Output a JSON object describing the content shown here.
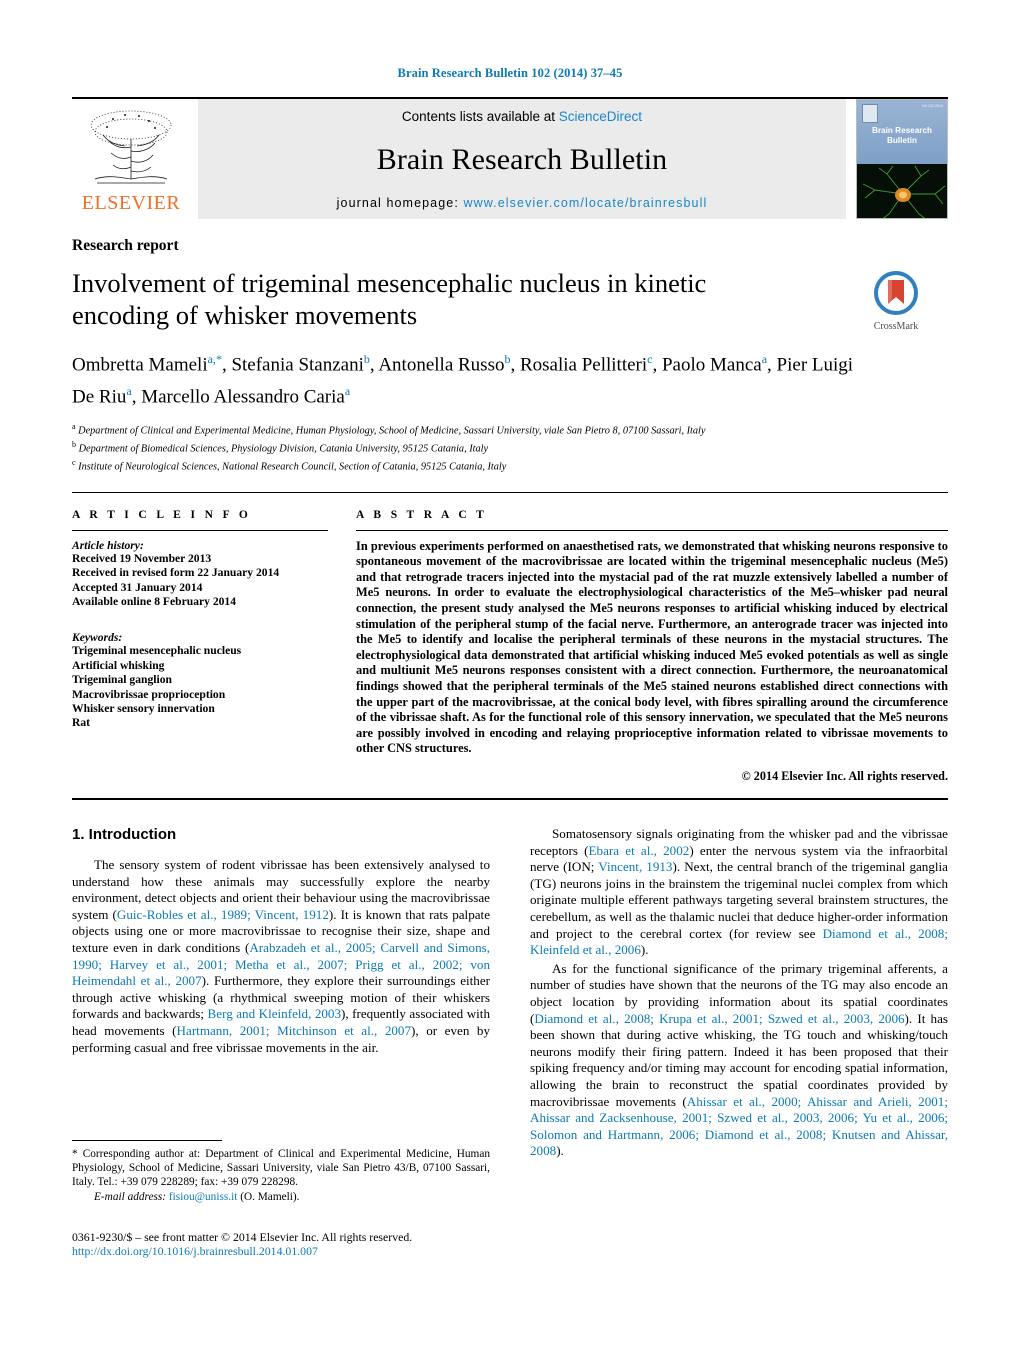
{
  "running_head": "Brain Research Bulletin 102 (2014) 37–45",
  "masthead": {
    "publisher_logo_name": "elsevier-tree-logo",
    "publisher_wordmark": "ELSEVIER",
    "contents_prefix": "Contents lists available at",
    "contents_link": "ScienceDirect",
    "journal_title": "Brain Research Bulletin",
    "homepage_label": "journal homepage:",
    "homepage_url": "www.elsevier.com/locate/brainresbull",
    "cover": {
      "journal_name_line1": "Brain Research",
      "journal_name_line2": "Bulletin",
      "issue_note": "Vol 102  2014"
    }
  },
  "article": {
    "type": "Research report",
    "title": "Involvement of trigeminal mesencephalic nucleus in kinetic encoding of whisker movements",
    "crossmark_label": "CrossMark",
    "authors_html": "Ombretta Mameli<sup>a,</sup><sup>*</sup>, Stefania Stanzani<sup>b</sup>, Antonella Russo<sup>b</sup>, Rosalia Pellitteri<sup>c</sup>, Paolo Manca<sup>a</sup>, Pier Luigi De Riu<sup>a</sup>, Marcello Alessandro Caria<sup>a</sup>",
    "affiliations": [
      {
        "marker": "a",
        "text": "Department of Clinical and Experimental Medicine, Human Physiology, School of Medicine, Sassari University, viale San Pietro 8, 07100 Sassari, Italy"
      },
      {
        "marker": "b",
        "text": "Department of Biomedical Sciences, Physiology Division, Catania University, 95125 Catania, Italy"
      },
      {
        "marker": "c",
        "text": "Institute of Neurological Sciences, National Research Council, Section of Catania, 95125 Catania, Italy"
      }
    ]
  },
  "article_info": {
    "heading": "A R T I C L E   I N F O",
    "history_label": "Article history:",
    "history": [
      "Received 19 November 2013",
      "Received in revised form 22 January 2014",
      "Accepted 31 January 2014",
      "Available online 8 February 2014"
    ],
    "keywords_label": "Keywords:",
    "keywords": [
      "Trigeminal mesencephalic nucleus",
      "Artificial whisking",
      "Trigeminal ganglion",
      "Macrovibrissae proprioception",
      "Whisker sensory innervation",
      "Rat"
    ]
  },
  "abstract": {
    "heading": "A B S T R A C T",
    "text": "In previous experiments performed on anaesthetised rats, we demonstrated that whisking neurons responsive to spontaneous movement of the macrovibrissae are located within the trigeminal mesencephalic nucleus (Me5) and that retrograde tracers injected into the mystacial pad of the rat muzzle extensively labelled a number of Me5 neurons. In order to evaluate the electrophysiological characteristics of the Me5–whisker pad neural connection, the present study analysed the Me5 neurons responses to artificial whisking induced by electrical stimulation of the peripheral stump of the facial nerve. Furthermore, an anterograde tracer was injected into the Me5 to identify and localise the peripheral terminals of these neurons in the mystacial structures. The electrophysiological data demonstrated that artificial whisking induced Me5 evoked potentials as well as single and multiunit Me5 neurons responses consistent with a direct connection. Furthermore, the neuroanatomical findings showed that the peripheral terminals of the Me5 stained neurons established direct connections with the upper part of the macrovibrissae, at the conical body level, with fibres spiralling around the circumference of the vibrissae shaft. As for the functional role of this sensory innervation, we speculated that the Me5 neurons are possibly involved in encoding and relaying proprioceptive information related to vibrissae movements to other CNS structures.",
    "copyright": "© 2014 Elsevier Inc. All rights reserved."
  },
  "body": {
    "section_number_title": "1.  Introduction",
    "left_paragraphs_html": [
      "The sensory system of rodent vibrissae has been extensively analysed to understand how these animals may successfully explore the nearby environment, detect objects and orient their behaviour using the macrovibrissae system (<span class=\"cite\">Guic-Robles et al., 1989; Vincent, 1912</span>). It is known that rats palpate objects using one or more macrovibrissae to recognise their size, shape and texture even in dark conditions (<span class=\"cite\">Arabzadeh et al., 2005; Carvell and Simons, 1990; Harvey et al., 2001; Metha et al., 2007; Prigg et al., 2002; von Heimendahl et al., 2007</span>). Furthermore, they explore their surroundings either through active whisking (a rhythmical sweeping motion of their whiskers forwards and backwards; <span class=\"cite\">Berg and Kleinfeld, 2003</span>), frequently associated with head movements (<span class=\"cite\">Hartmann, 2001; Mitchinson et al., 2007</span>), or even by performing casual and free vibrissae movements in the air."
    ],
    "right_paragraphs_html": [
      "Somatosensory signals originating from the whisker pad and the vibrissae receptors (<span class=\"cite\">Ebara et al., 2002</span>) enter the nervous system via the infraorbital nerve (ION; <span class=\"cite\">Vincent, 1913</span>). Next, the central branch of the trigeminal ganglia (TG) neurons joins in the brainstem the trigeminal nuclei complex from which originate multiple efferent pathways targeting several brainstem structures, the cerebellum, as well as the thalamic nuclei that deduce higher-order information and project to the cerebral cortex (for review see <span class=\"cite\">Diamond et al., 2008; Kleinfeld et al., 2006</span>).",
      "As for the functional significance of the primary trigeminal afferents, a number of studies have shown that the neurons of the TG may also encode an object location by providing information about its spatial coordinates (<span class=\"cite\">Diamond et al., 2008; Krupa et al., 2001; Szwed et al., 2003, 2006</span>). It has been shown that during active whisking, the TG touch and whisking/touch neurons modify their firing pattern. Indeed it has been proposed that their spiking frequency and/or timing may account for encoding spatial information, allowing the brain to reconstruct the spatial coordinates provided by macrovibrissae movements (<span class=\"cite\">Ahissar et al., 2000; Ahissar and Arieli, 2001; Ahissar and Zacksenhouse, 2001; Szwed et al., 2003, 2006; Yu et al., 2006; Solomon and Hartmann, 2006; Diamond et al., 2008; Knutsen and Ahissar, 2008</span>)."
    ]
  },
  "footnote": {
    "corresponding_html": "* Corresponding author at: Department of Clinical and Experimental Medicine, Human Physiology, School of Medicine, Sassari University, viale San Pietro 43/B, 07100 Sassari, Italy. Tel.: +39 079 228289; fax: +39 079 228298.",
    "email_label": "E-mail address:",
    "email": "fisiou@uniss.it",
    "email_owner": "(O. Mameli)."
  },
  "imprint": {
    "issn_line": "0361-9230/$ – see front matter © 2014 Elsevier Inc. All rights reserved.",
    "doi": "http://dx.doi.org/10.1016/j.brainresbull.2014.01.007"
  },
  "colors": {
    "link_blue": "#0b7ab5",
    "elsevier_orange": "#f06e28",
    "masthead_grey": "#ebebeb"
  }
}
